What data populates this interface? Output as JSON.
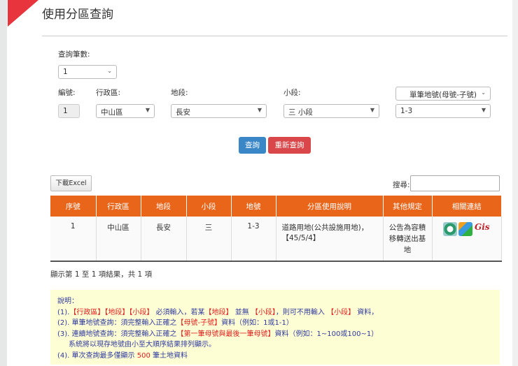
{
  "page": {
    "title": "使用分區查詢"
  },
  "form": {
    "count_label": "查詢筆數:",
    "count_value": "1",
    "no_label": "編號:",
    "no_value": "1",
    "district_label": "行政區:",
    "district_value": "中山區",
    "section_label": "地段:",
    "section_value": "長安",
    "subsection_label": "小段:",
    "subsection_value": "三 小段",
    "lot_type_value": "單筆地號(母號-子號)",
    "lot_value": "1-3",
    "query_button": "查詢",
    "reset_button": "重新查詢"
  },
  "table": {
    "excel_button": "下載Excel",
    "search_label": "搜尋:",
    "search_value": "",
    "headers": [
      "序號",
      "行政區",
      "地段",
      "小段",
      "地號",
      "分區使用說明",
      "其他規定",
      "相關連結"
    ],
    "rows": [
      {
        "no": "1",
        "district": "中山區",
        "section": "長安",
        "subsection": "三",
        "lot": "1-3",
        "zoning": "道路用地(公共設施用地)，【45/5/4】",
        "other": "公告為容積移轉送出基地"
      }
    ],
    "info": "顯示第 1 至 1 項結果，共 1 項"
  },
  "notes": {
    "title": "說明：",
    "n1_a": "(1).",
    "n1_b": "【行政區】【地段】【小段】",
    "n1_c": "必須輸入，若某",
    "n1_d": "【地段】",
    "n1_e": "並無",
    "n1_f": "【小段】",
    "n1_g": "，則可不用輸入",
    "n1_h": "【小段】",
    "n1_i": "資料，",
    "n2_a": "(2). 單筆地號查詢：須完整輸入正確之",
    "n2_b": "【母號-子號】",
    "n2_c": "資料（例如：1或1-1）",
    "n3_a": "(3). 連續地號查詢：須完整輸入正確之",
    "n3_b": "【第一筆母號與最後一筆母號】",
    "n3_c": "資料（例如：1~100或100~1）",
    "n3_d": "系統將以現存地號由小至大順序結果排列顯示。",
    "n4_a": "(4). 單次查詢最多僅顯示",
    "n4_b": "500",
    "n4_c": "筆土地資料"
  },
  "colors": {
    "accent": "#e8651a",
    "primary": "#3a87c8",
    "danger": "#d9474a",
    "note_bg": "#fefed4"
  }
}
